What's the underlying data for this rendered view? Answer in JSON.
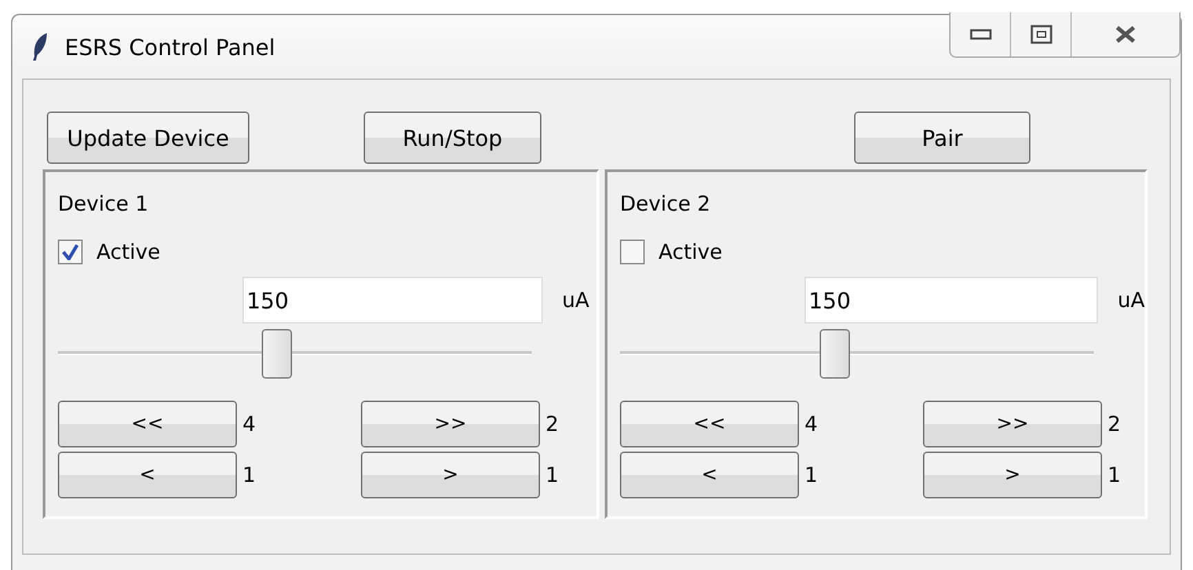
{
  "window": {
    "title": "ESRS Control Panel"
  },
  "toolbar": [
    "Update Device",
    "Run/Stop",
    "Pair"
  ],
  "devices": [
    {
      "title": "Device 1",
      "active": {
        "label": "Active",
        "checked": true
      },
      "value": "150",
      "unit": "uA",
      "level": 0.46,
      "steps": [
        {
          "label": "<<",
          "count": "4"
        },
        {
          "label": ">>",
          "count": "2"
        },
        {
          "label": "<",
          "count": "1"
        },
        {
          "label": ">",
          "count": "1"
        }
      ]
    },
    {
      "title": "Device 2",
      "active": {
        "label": "Active",
        "checked": false
      },
      "value": "150",
      "unit": "uA",
      "level": 0.45,
      "steps": [
        {
          "label": "<<",
          "count": "4"
        },
        {
          "label": ">>",
          "count": "2"
        },
        {
          "label": "<",
          "count": "1"
        },
        {
          "label": ">",
          "count": "1"
        }
      ]
    }
  ]
}
